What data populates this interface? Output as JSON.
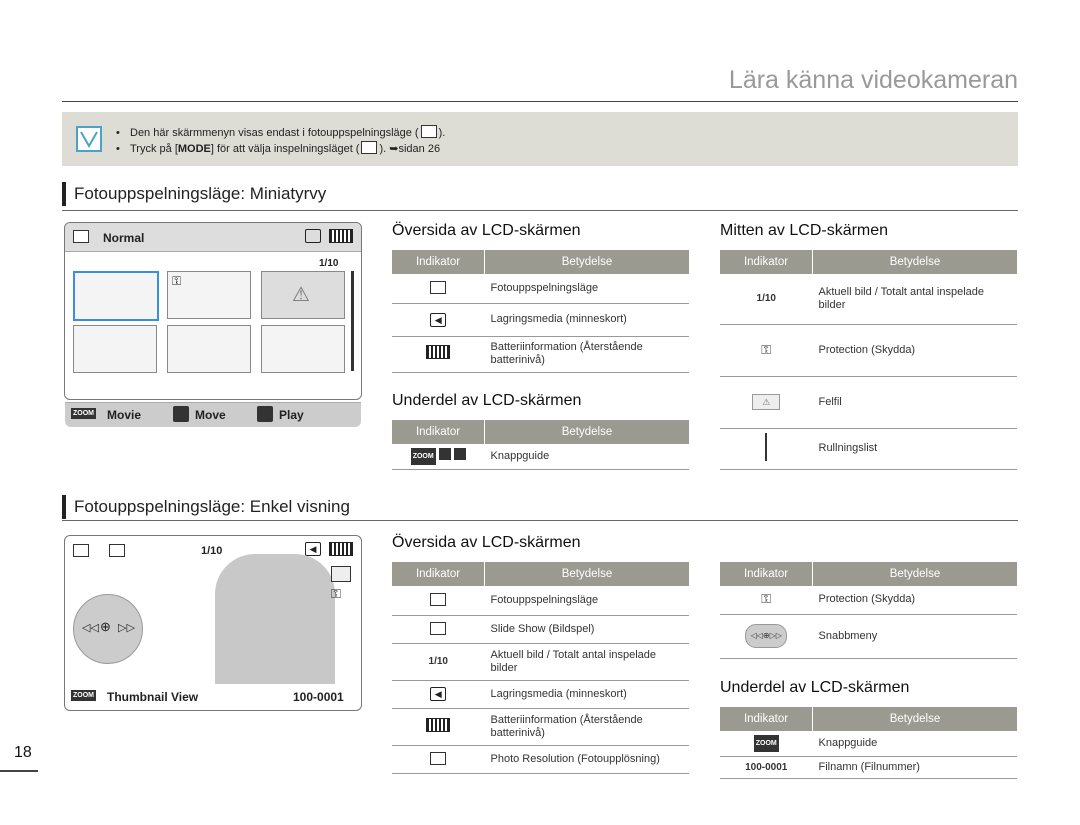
{
  "header": {
    "title": "Lära känna videokameran"
  },
  "note": {
    "line1": "Den här skärmmenyn visas endast i fotouppspelningsläge (",
    "line1_end": ").",
    "line2_pre": "Tryck på [",
    "line2_key": "MODE",
    "line2_mid": "] för att välja inspelningsläget (",
    "line2_end": "). ",
    "line2_ref": "➥sidan 26"
  },
  "section1": {
    "title": "Fotouppspelningsläge: Miniatyrvy"
  },
  "section2": {
    "title": "Fotouppspelningsläge: Enkel visning"
  },
  "columns": {
    "indikator": "Indikator",
    "betydelse": "Betydelse"
  },
  "thumbs_screen": {
    "mode_label": "Normal",
    "counter": "1/10",
    "zoom": "ZOOM",
    "movie": "Movie",
    "move": "Move",
    "play": "Play"
  },
  "single_screen": {
    "counter": "1/10",
    "zoom": "ZOOM",
    "thumb_view": "Thumbnail View",
    "file": "100-0001"
  },
  "s1_top": {
    "heading": "Översida av LCD-skärmen",
    "rows": [
      {
        "icon": "photo-playback-mode-icon",
        "text": "Fotouppspelningsläge"
      },
      {
        "icon": "storage-card-icon",
        "text": "Lagringsmedia (minneskort)"
      },
      {
        "icon": "battery-icon",
        "text": "Batteriinformation (Återstående batterinivå)"
      }
    ]
  },
  "s1_bottom": {
    "heading": "Underdel av LCD-skärmen",
    "rows": [
      {
        "icon": "button-guide-icon",
        "text": "Knappguide"
      }
    ]
  },
  "s1_middle": {
    "heading": "Mitten av LCD-skärmen",
    "rows": [
      {
        "indicator": "1/10",
        "text": "Aktuell bild / Totalt antal inspelade bilder"
      },
      {
        "icon": "protection-key-icon",
        "text": "Protection (Skydda)"
      },
      {
        "icon": "error-warning-icon",
        "text": "Felfil"
      },
      {
        "icon": "scrollbar-icon",
        "text": "Rullningslist"
      }
    ]
  },
  "s2_top": {
    "heading": "Översida av LCD-skärmen",
    "rows": [
      {
        "icon": "photo-playback-mode-icon",
        "text": "Fotouppspelningsläge"
      },
      {
        "icon": "slideshow-icon",
        "text": "Slide Show (Bildspel)"
      },
      {
        "indicator": "1/10",
        "text": "Aktuell bild / Totalt antal inspelade bilder"
      },
      {
        "icon": "storage-card-icon",
        "text": "Lagringsmedia (minneskort)"
      },
      {
        "icon": "battery-icon",
        "text": "Batteriinformation (Återstående batterinivå)"
      },
      {
        "icon": "photo-resolution-icon",
        "text": "Photo Resolution (Fotoupplösning)"
      }
    ]
  },
  "s2_right": {
    "rows": [
      {
        "icon": "protection-key-icon",
        "text": "Protection (Skydda)"
      },
      {
        "icon": "quick-menu-icon",
        "text": "Snabbmeny"
      }
    ]
  },
  "s2_bottom": {
    "heading": "Underdel av LCD-skärmen",
    "rows": [
      {
        "indicator": "ZOOM",
        "text": "Knappguide"
      },
      {
        "indicator": "100-0001",
        "text": "Filnamn (Filnummer)"
      }
    ]
  },
  "page": {
    "number": "18"
  }
}
